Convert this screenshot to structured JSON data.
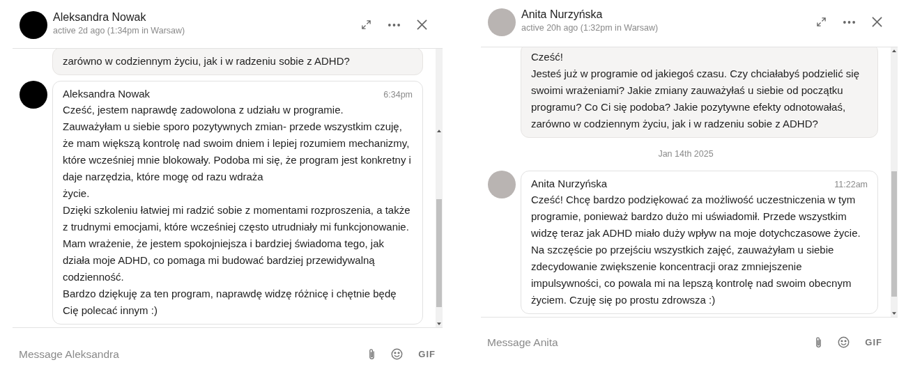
{
  "panels": [
    {
      "contact": {
        "name": "Aleksandra Nowak",
        "status": "active 2d ago (1:34pm in Warsaw)",
        "avatar": {
          "kind": "blank"
        }
      },
      "messages": [
        {
          "kind": "message",
          "outgoing": true,
          "text": "zarówno w codziennym życiu, jak i w radzeniu sobie z ADHD?"
        },
        {
          "kind": "message",
          "outgoing": false,
          "sender": "Aleksandra Nowak",
          "time": "6:34pm",
          "avatar": {
            "kind": "blank"
          },
          "text": "Cześć, jestem naprawdę zadowolona z udziału w programie.\nZauważyłam u siebie sporo pozytywnych zmian- przede wszystkim czuję, że mam większą kontrolę nad swoim dniem i lepiej rozumiem mechanizmy, które wcześniej mnie blokowały. Podoba mi się, że program jest konkretny i daje narzędzia, które mogę od razu wdraża\nżycie.\nDzięki szkoleniu łatwiej mi radzić sobie z momentami rozproszenia, a także z trudnymi emocjami, które wcześniej często utrudniały mi funkcjonowanie. Mam wrażenie, że jestem spokojniejsza i bardziej świadoma tego, jak działa moje ADHD, co pomaga mi budować bardziej przewidywalną codzienność.\nBardzo dziękuję za ten program, naprawdę widzę różnicę i chętnie będę Cię polecać innym :)"
        }
      ],
      "composer": {
        "placeholder": "Message Aleksandra",
        "gif_label": "GIF"
      }
    },
    {
      "contact": {
        "name": "Anita Nurzyńska",
        "status": "active 20h ago (1:32pm in Warsaw)",
        "avatar": {
          "kind": "photo"
        }
      },
      "messages": [
        {
          "kind": "message",
          "outgoing": true,
          "text": "Cześć!\nJesteś już w programie od jakiegoś czasu. Czy chciałabyś podzielić się swoimi wrażeniami? Jakie zmiany zauważyłaś u siebie od początku programu? Co Ci się podoba? Jakie pozytywne efekty odnotowałaś, zarówno w codziennym życiu, jak i w radzeniu sobie z ADHD?"
        },
        {
          "kind": "date",
          "text": "Jan 14th 2025"
        },
        {
          "kind": "message",
          "outgoing": false,
          "sender": "Anita Nurzyńska",
          "time": "11:22am",
          "avatar": {
            "kind": "photo"
          },
          "text": "Cześć! Chcę bardzo podziękować za możliwość uczestniczenia w tym programie, ponieważ bardzo dużo mi uświadomił. Przede wszystkim widzę teraz jak ADHD miało duży wpływ na moje dotychczasowe życie. Na szczęście po przejściu wszystkich zajęć, zauważyłam u siebie zdecydowanie zwiększenie koncentracji oraz zmniejszenie impulsywności, co powala mi na lepszą kontrolę nad swoim obecnym życiem. Czuję się po prostu zdrowsza :)"
        }
      ],
      "composer": {
        "placeholder": "Message Anita",
        "gif_label": "GIF"
      }
    }
  ]
}
